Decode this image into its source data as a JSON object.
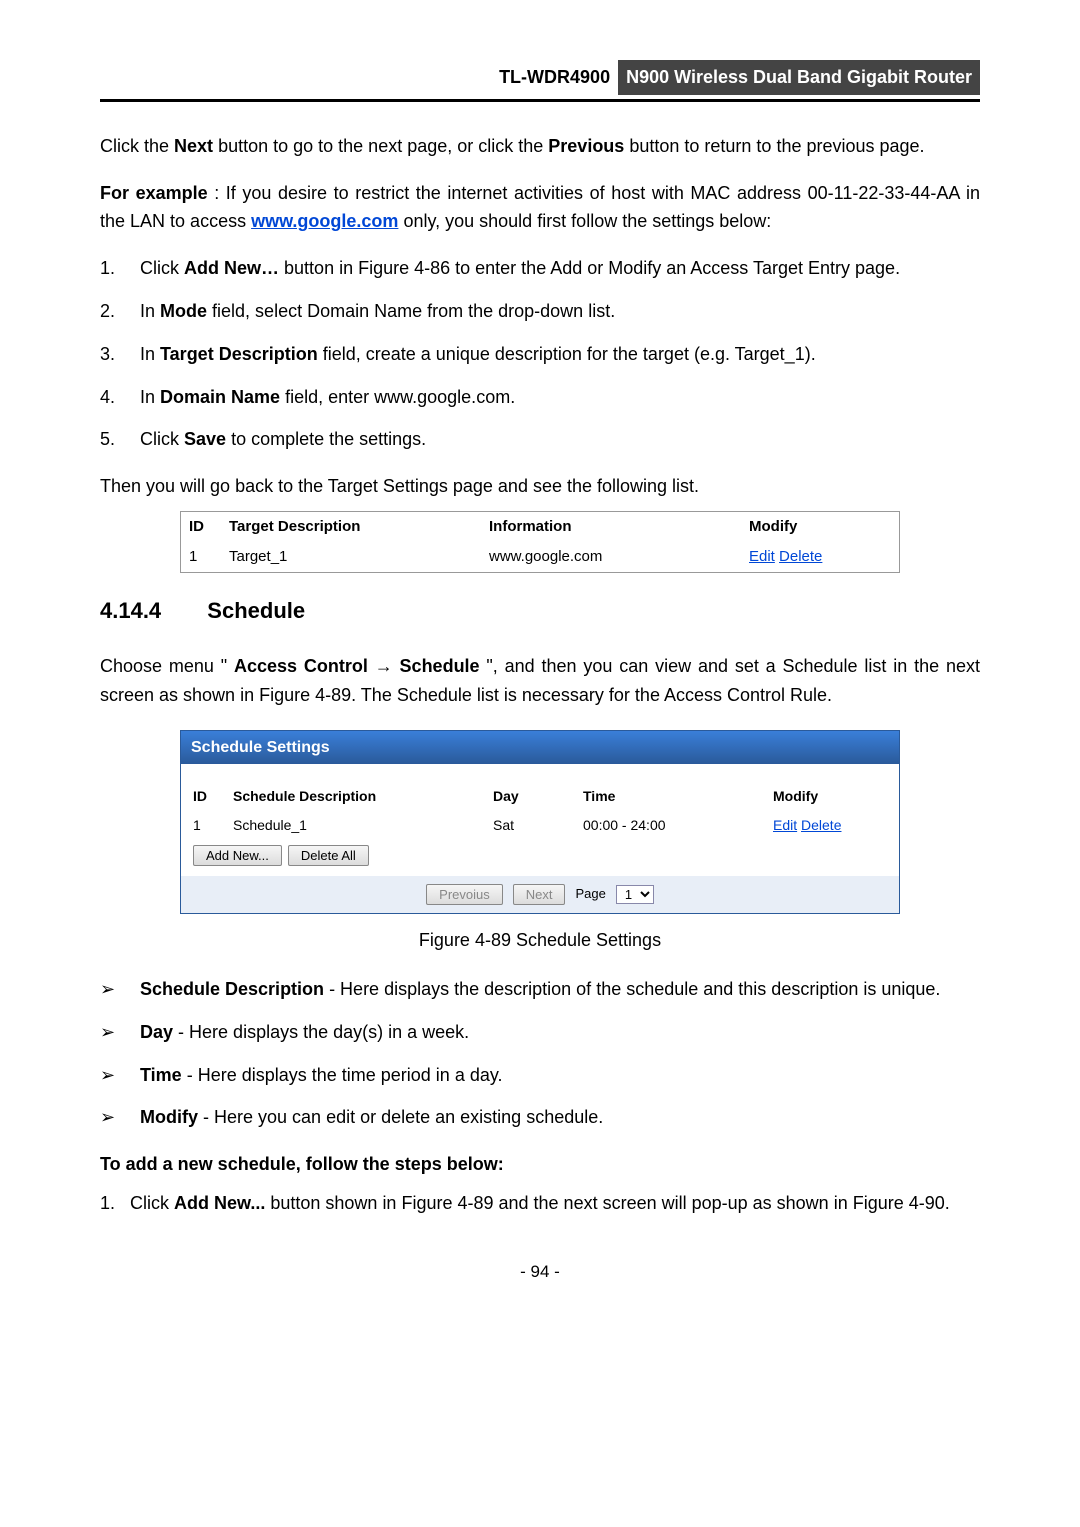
{
  "header": {
    "model": "TL-WDR4900",
    "product": "N900 Wireless Dual Band Gigabit Router"
  },
  "p1": {
    "t1": "Click the ",
    "b1": "Next",
    "t2": " button to go to the next page, or click the ",
    "b2": "Previous",
    "t3": " button to return to the previous page."
  },
  "p2": {
    "b1": "For example",
    "t1": ": If you desire to restrict the internet activities of host with MAC address 00-11-22-33-44-AA in the LAN to access ",
    "link": "www.google.com",
    "t2": " only, you should first follow the settings below:"
  },
  "steps": [
    {
      "t1": "Click ",
      "b": "Add New…",
      "t2": " button in Figure 4-86 to enter the Add or Modify an Access Target Entry page."
    },
    {
      "t1": "In ",
      "b": "Mode",
      "t2": " field, select Domain Name from the drop-down list."
    },
    {
      "t1": "In ",
      "b": "Target Description",
      "t2": " field, create a unique description for the target (e.g. Target_1)."
    },
    {
      "t1": "In ",
      "b": "Domain Name",
      "t2": " field, enter www.google.com."
    },
    {
      "t1": "Click ",
      "b": "Save",
      "t2": " to complete the settings."
    }
  ],
  "p3": "Then you will go back to the Target Settings page and see the following list.",
  "tbl1": {
    "h1": "ID",
    "h2": "Target Description",
    "h3": "Information",
    "h4": "Modify",
    "r1": {
      "id": "1",
      "desc": "Target_1",
      "info": "www.google.com",
      "edit": "Edit",
      "del": "Delete"
    }
  },
  "section": {
    "num": "4.14.4",
    "title": "Schedule"
  },
  "p4": {
    "t1": "Choose menu \"",
    "b1": "Access Control",
    "arrow": " → ",
    "b2": "Schedule",
    "t2": "\", and then you can view and set a Schedule list in the next screen as shown in Figure 4-89. The Schedule list is necessary for the Access Control Rule."
  },
  "sched": {
    "title": "Schedule Settings",
    "h1": "ID",
    "h2": "Schedule Description",
    "h3": "Day",
    "h4": "Time",
    "h5": "Modify",
    "r1": {
      "id": "1",
      "desc": "Schedule_1",
      "day": "Sat",
      "time": "00:00 - 24:00",
      "edit": "Edit",
      "del": "Delete"
    },
    "addnew": "Add New...",
    "deleteall": "Delete All",
    "prev": "Prevoius",
    "next": "Next",
    "pagelabel": "Page",
    "pagenum": "1"
  },
  "figcap": "Figure 4-89 Schedule Settings",
  "bullets": [
    {
      "b": "Schedule Description",
      "t": " - Here displays the description of the schedule and this description is unique."
    },
    {
      "b": "Day",
      "t": " - Here displays the day(s) in a week."
    },
    {
      "b": "Time",
      "t": " - Here displays the time period in a day."
    },
    {
      "b": "Modify",
      "t": " - Here you can edit or delete an existing schedule."
    }
  ],
  "p5": "To add a new schedule, follow the steps below:",
  "steps2": [
    {
      "t1": "Click ",
      "b": "Add New...",
      "t2": " button shown in Figure 4-89 and the next screen will pop-up as shown in Figure 4-90."
    }
  ],
  "pagenum": "- 94 -"
}
